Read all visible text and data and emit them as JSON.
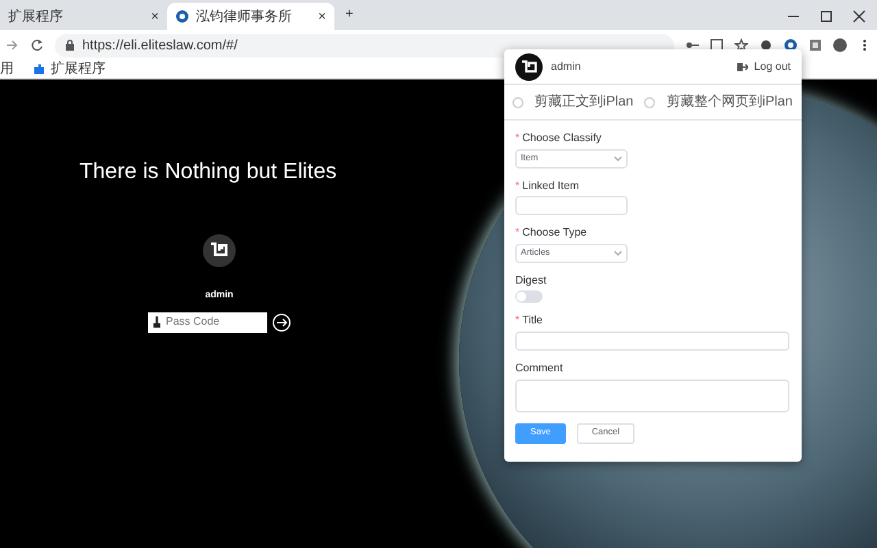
{
  "browser": {
    "tabs": [
      {
        "title": "扩展程序",
        "close": "×",
        "selected": false
      },
      {
        "title": "泓钧律师事务所",
        "close": "×",
        "selected": true
      }
    ],
    "new_tab": "+",
    "url": "https://eli.eliteslaw.com/#/",
    "bookmarks": [
      "用",
      "扩展程序"
    ]
  },
  "page": {
    "headline": "There is Nothing but Elites",
    "user": "admin",
    "passcode": {
      "placeholder": "Pass Code"
    }
  },
  "popup": {
    "user": "admin",
    "logout": "Log out",
    "clip_options": [
      {
        "label": "剪藏正文到iPlan",
        "selected": false
      },
      {
        "label": "剪藏整个网页到iPlan",
        "selected": false
      }
    ],
    "fields": [
      {
        "kind": "select",
        "marker": "*",
        "label": "Choose Classify",
        "value": "Item"
      },
      {
        "kind": "text",
        "marker": "*",
        "label": "Linked Item"
      },
      {
        "kind": "select",
        "marker": "*",
        "label": "Choose Type",
        "value": "Articles"
      },
      {
        "kind": "switch",
        "label": "Digest",
        "on": false
      },
      {
        "kind": "longtext",
        "marker": "*",
        "label": "Title"
      },
      {
        "kind": "textarea",
        "label": "Comment"
      }
    ],
    "buttons": [
      {
        "kind": "primary",
        "label": "Save"
      },
      {
        "kind": "default",
        "label": "Cancel"
      }
    ]
  }
}
